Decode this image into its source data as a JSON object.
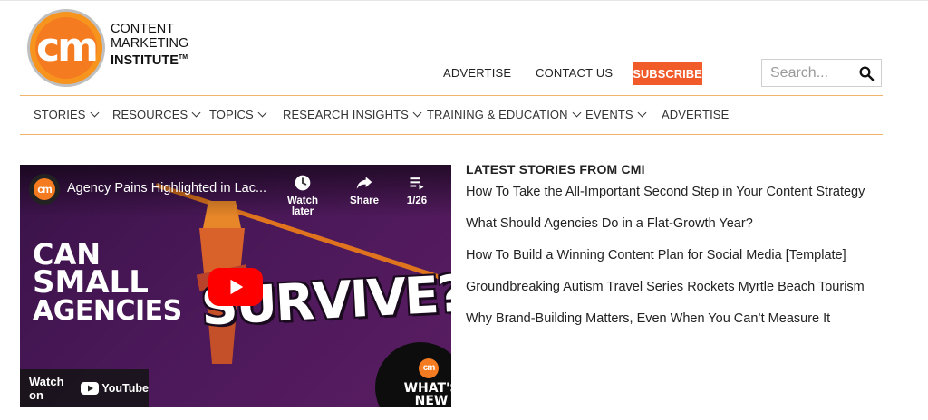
{
  "logo": {
    "mark": "cm",
    "line1": "CONTENT",
    "line2": "MARKETING",
    "line3": "INSTITUTE",
    "trademark": "TM"
  },
  "header": {
    "links": [
      "ADVERTISE",
      "CONTACT US"
    ],
    "subscribe_label": "SUBSCRIBE",
    "search_placeholder": "Search...",
    "accent_color": "#f15a29"
  },
  "nav": {
    "items": [
      {
        "label": "STORIES",
        "has_dropdown": true
      },
      {
        "label": "RESOURCES",
        "has_dropdown": true
      },
      {
        "label": "TOPICS",
        "has_dropdown": true
      },
      {
        "label": "RESEARCH INSIGHTS",
        "has_dropdown": true
      },
      {
        "label": "TRAINING & EDUCATION",
        "has_dropdown": true
      },
      {
        "label": "EVENTS",
        "has_dropdown": true
      },
      {
        "label": "ADVERTISE",
        "has_dropdown": false
      }
    ]
  },
  "video": {
    "channel_mark": "cm",
    "title": "Agency Pains Highlighted in Lac...",
    "controls": {
      "watch_later": "Watch later",
      "share": "Share",
      "playlist_count": "1/26"
    },
    "thumb_text": {
      "line1": "CAN",
      "line2": "SMALL",
      "line3": "AGENCIES",
      "line4": "SURVIVE?"
    },
    "watch_on_label": "Watch on",
    "youtube_word": "YouTube",
    "badge": {
      "mark": "cm",
      "line1": "WHAT'S",
      "line2": "NEW"
    }
  },
  "latest": {
    "heading": "LATEST STORIES FROM CMI",
    "stories": [
      "How To Take the All-Important Second Step in Your Content Strategy",
      "What Should Agencies Do in a Flat-Growth Year?",
      "How To Build a Winning Content Plan for Social Media [Template]",
      "Groundbreaking Autism Travel Series Rockets Myrtle Beach Tourism",
      "Why Brand-Building Matters, Even When You Can’t Measure It"
    ]
  }
}
